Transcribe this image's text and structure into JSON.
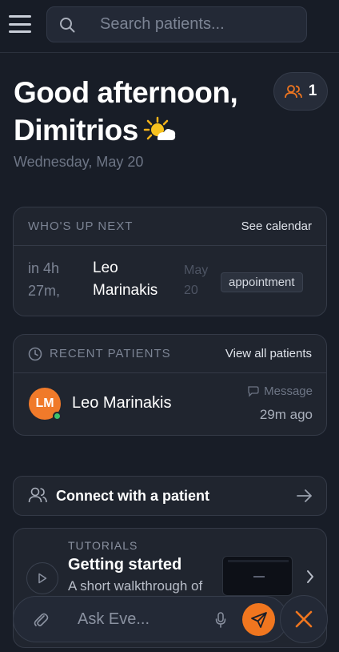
{
  "search": {
    "placeholder": "Search patients..."
  },
  "greeting": {
    "line1": "Good afternoon,",
    "line2": "Dimitrios",
    "date": "Wednesday, May 20"
  },
  "team": {
    "count": "1"
  },
  "up_next": {
    "label": "WHO'S UP NEXT",
    "link": "See calendar",
    "time": "in 4h 27m,",
    "name": "Leo Marinakis",
    "date": "May 20",
    "badge": "appointment"
  },
  "recent": {
    "label": "RECENT PATIENTS",
    "link": "View all patients",
    "patients": [
      {
        "initials": "LM",
        "name": "Leo Marinakis",
        "action": "Message",
        "ago": "29m ago"
      }
    ]
  },
  "connect": {
    "label": "Connect with a patient"
  },
  "tutorial": {
    "label": "TUTORIALS",
    "title": "Getting started",
    "desc": "A short walkthrough of"
  },
  "chat": {
    "placeholder": "Ask Eve..."
  },
  "colors": {
    "accent": "#f0761f",
    "online": "#3ec26b",
    "background": "#181d27",
    "card": "#20252f"
  },
  "icons": [
    "menu-icon",
    "search-icon",
    "users-icon",
    "clock-icon",
    "message-icon",
    "arrow-right-icon",
    "play-icon",
    "chevron-right-icon",
    "paperclip-icon",
    "mic-icon",
    "send-icon",
    "close-icon",
    "sun-cloud-icon"
  ]
}
